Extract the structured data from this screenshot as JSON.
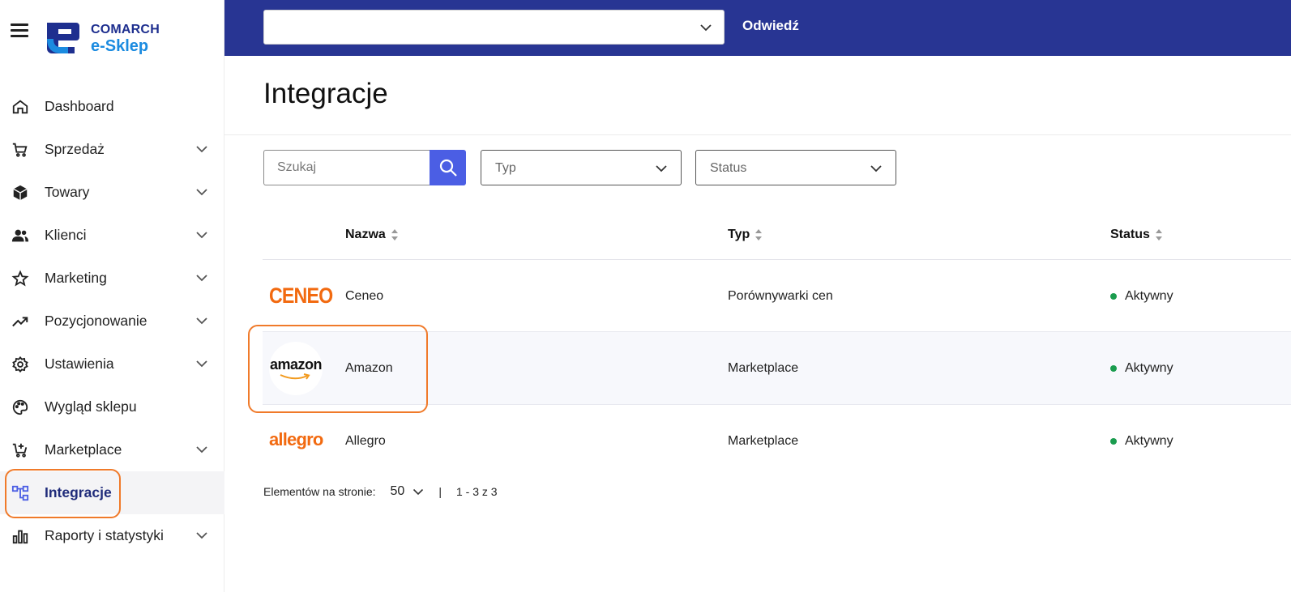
{
  "brand": {
    "line1": "COMARCH",
    "line2": "e-Sklep"
  },
  "colors": {
    "topbar": "#283593",
    "accent": "#4b5ee4",
    "highlight": "#f07a2a",
    "active_status": "#1a9c4e"
  },
  "sidebar": {
    "items": [
      {
        "label": "Dashboard",
        "icon": "home-icon",
        "expandable": false
      },
      {
        "label": "Sprzedaż",
        "icon": "cart-icon",
        "expandable": true
      },
      {
        "label": "Towary",
        "icon": "box-icon",
        "expandable": true
      },
      {
        "label": "Klienci",
        "icon": "users-icon",
        "expandable": true
      },
      {
        "label": "Marketing",
        "icon": "star-icon",
        "expandable": true
      },
      {
        "label": "Pozycjonowanie",
        "icon": "trending-icon",
        "expandable": true
      },
      {
        "label": "Ustawienia",
        "icon": "gear-icon",
        "expandable": true
      },
      {
        "label": "Wygląd sklepu",
        "icon": "palette-icon",
        "expandable": false
      },
      {
        "label": "Marketplace",
        "icon": "cart-plus-icon",
        "expandable": true
      },
      {
        "label": "Integracje",
        "icon": "integrations-icon",
        "expandable": false,
        "active": true
      },
      {
        "label": "Raporty i statystyki",
        "icon": "bar-chart-icon",
        "expandable": true
      }
    ]
  },
  "topbar": {
    "shop_select_value": "",
    "visit_label": "Odwiedź"
  },
  "page": {
    "title": "Integracje"
  },
  "filters": {
    "search_placeholder": "Szukaj",
    "type_label": "Typ",
    "status_label": "Status"
  },
  "table": {
    "columns": {
      "name": "Nazwa",
      "type": "Typ",
      "status": "Status"
    },
    "rows": [
      {
        "logo": "CENEO",
        "name": "Ceneo",
        "type": "Porównywarki cen",
        "status": "Aktywny"
      },
      {
        "logo": "amazon",
        "name": "Amazon",
        "type": "Marketplace",
        "status": "Aktywny"
      },
      {
        "logo": "allegro",
        "name": "Allegro",
        "type": "Marketplace",
        "status": "Aktywny"
      }
    ]
  },
  "pagination": {
    "label": "Elementów na stronie:",
    "page_size": "50",
    "divider": "|",
    "range": "1 - 3 z 3"
  }
}
